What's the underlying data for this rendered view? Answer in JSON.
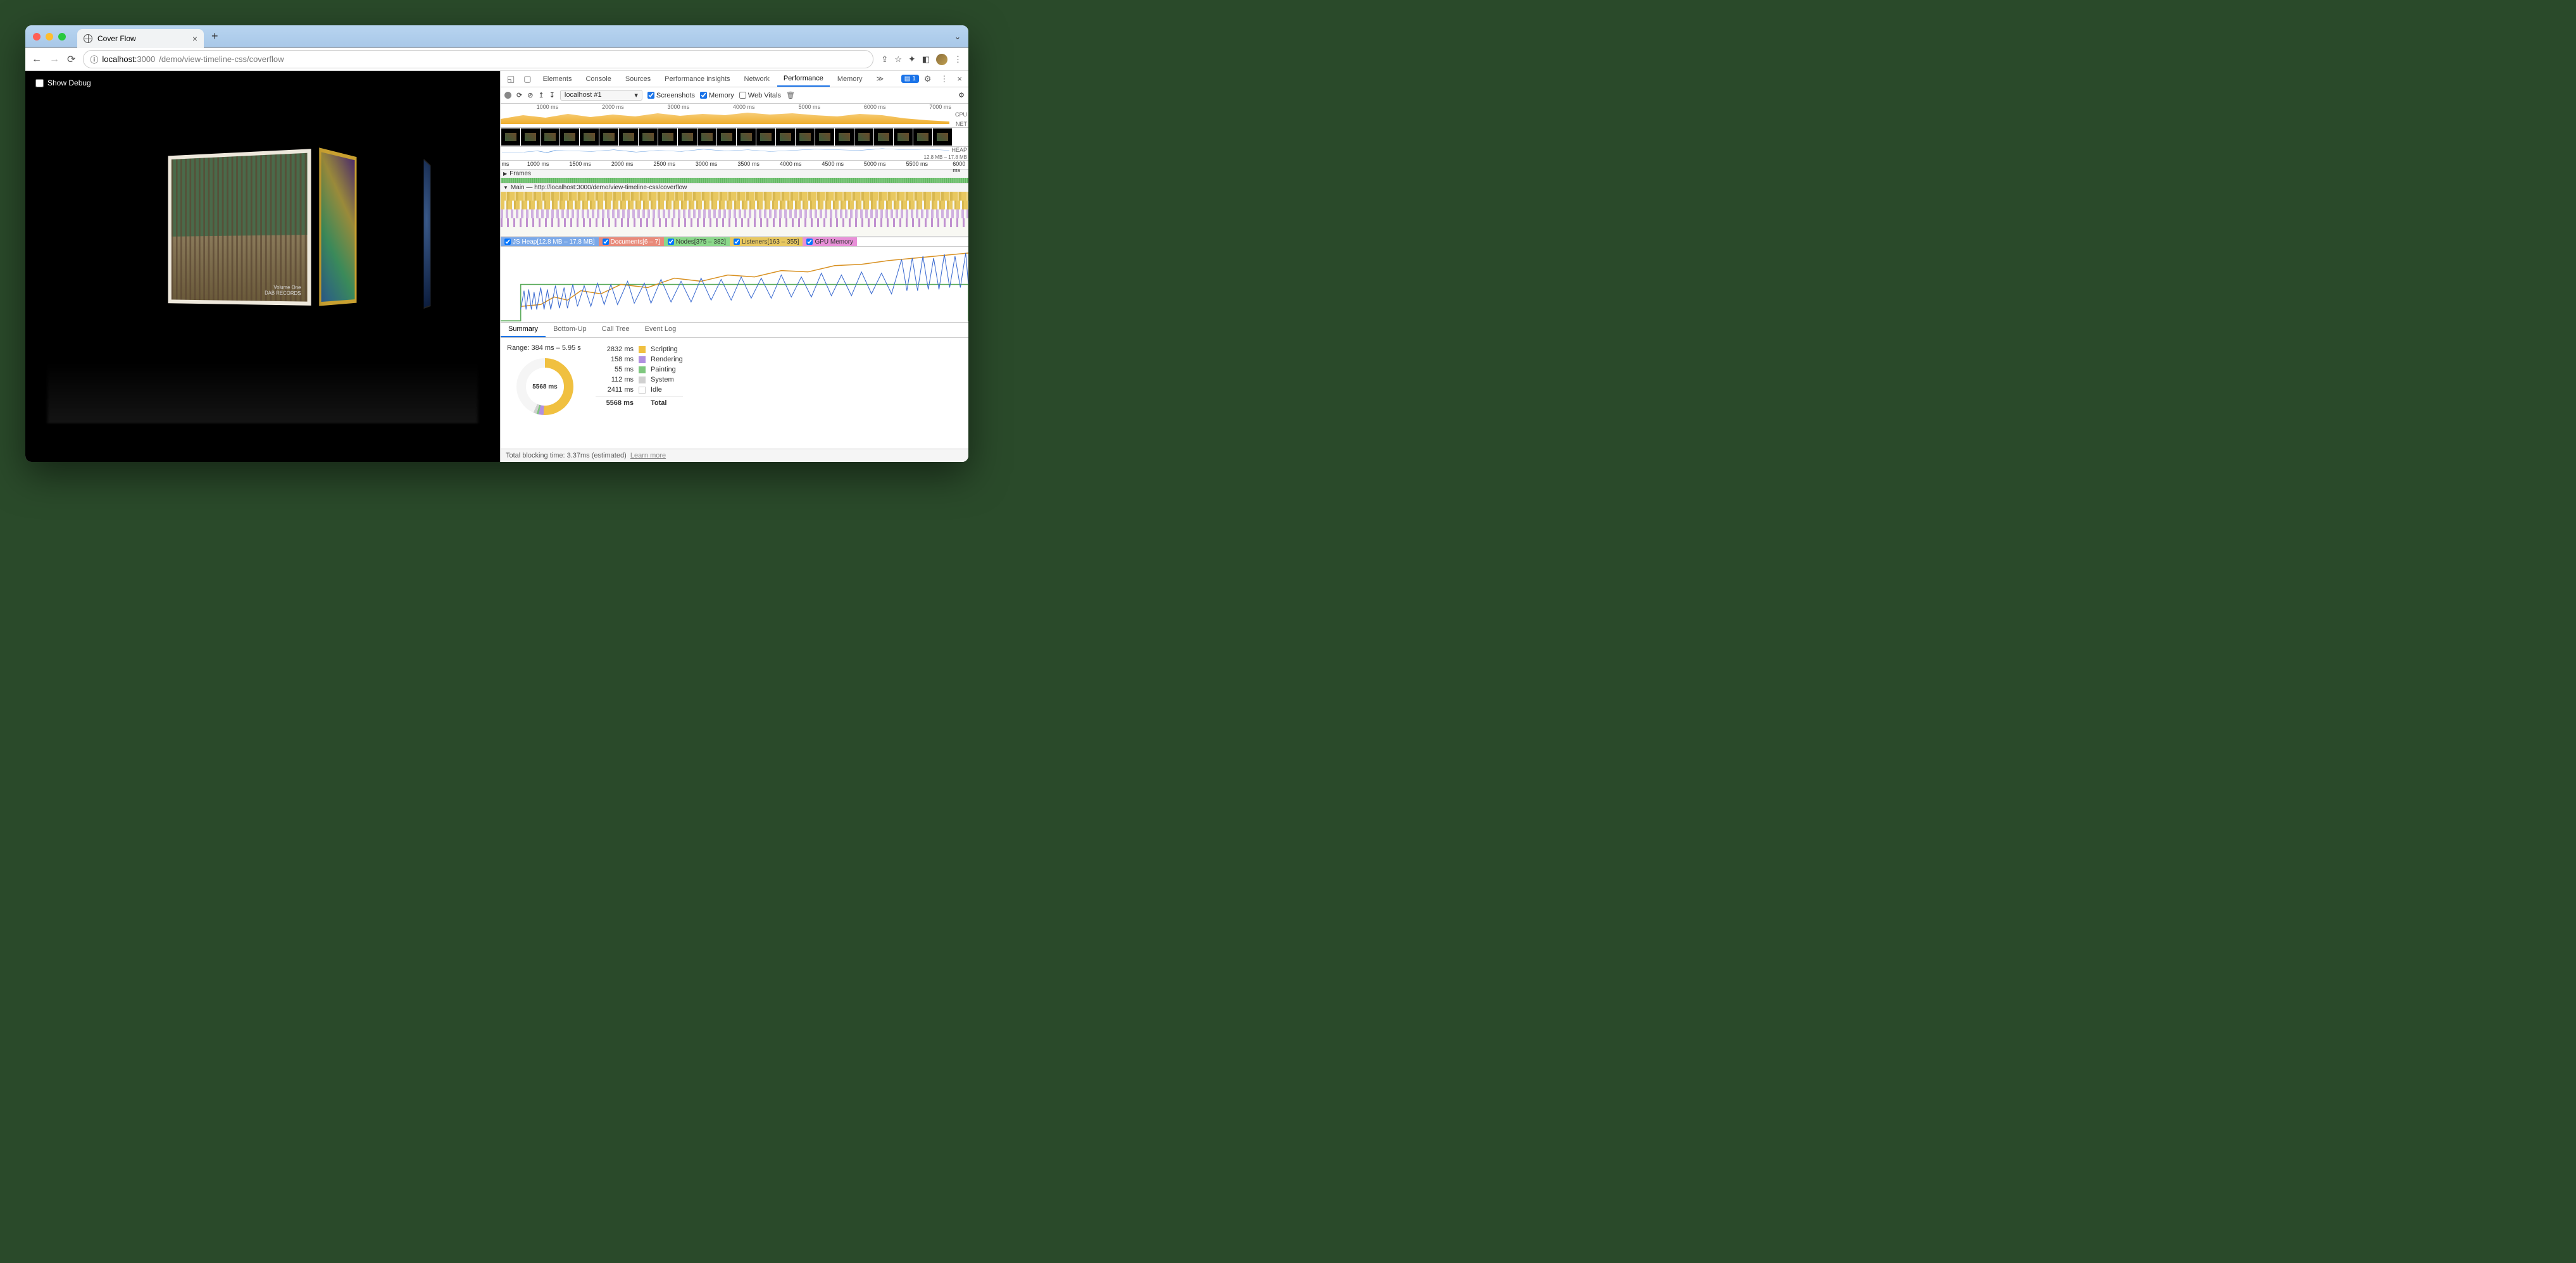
{
  "browser": {
    "tab_title": "Cover Flow",
    "url_host": "localhost:",
    "url_port": "3000",
    "url_path": "/demo/view-timeline-css/coverflow"
  },
  "page": {
    "debug_label": "Show Debug",
    "cover_main_label": "Volume One\nDAB RECORDS"
  },
  "devtools": {
    "tabs": [
      "Elements",
      "Console",
      "Sources",
      "Performance insights",
      "Network",
      "Performance",
      "Memory"
    ],
    "active_tab": "Performance",
    "more": "≫",
    "issue_count": "1",
    "toolbar": {
      "profile_select": "localhost #1",
      "screenshots": "Screenshots",
      "memory": "Memory",
      "web_vitals": "Web Vitals"
    },
    "overview_ticks": [
      "1000 ms",
      "2000 ms",
      "3000 ms",
      "4000 ms",
      "5000 ms",
      "6000 ms",
      "7000 ms"
    ],
    "cpu_label": "CPU",
    "net_label": "NET",
    "heap_label": "HEAP",
    "heap_range": "12.8 MB – 17.8 MB",
    "ruler2_ticks": [
      "ms",
      "1000 ms",
      "1500 ms",
      "2000 ms",
      "2500 ms",
      "3000 ms",
      "3500 ms",
      "4000 ms",
      "4500 ms",
      "5000 ms",
      "5500 ms",
      "6000 ms"
    ],
    "frames_label": "Frames",
    "main_label": "Main — http://localhost:3000/demo/view-timeline-css/coverflow",
    "counters": {
      "heap": "JS Heap[12.8 MB – 17.8 MB]",
      "docs": "Documents[6 – 7]",
      "nodes": "Nodes[375 – 382]",
      "listeners": "Listeners[163 – 355]",
      "gpu": "GPU Memory"
    },
    "detail_tabs": [
      "Summary",
      "Bottom-Up",
      "Call Tree",
      "Event Log"
    ],
    "range": "Range: 384 ms – 5.95 s",
    "donut_total": "5568 ms",
    "legend": [
      {
        "ms": "2832 ms",
        "label": "Scripting",
        "cls": "script"
      },
      {
        "ms": "158 ms",
        "label": "Rendering",
        "cls": "render"
      },
      {
        "ms": "55 ms",
        "label": "Painting",
        "cls": "paint"
      },
      {
        "ms": "112 ms",
        "label": "System",
        "cls": "sys"
      },
      {
        "ms": "2411 ms",
        "label": "Idle",
        "cls": "idle"
      }
    ],
    "total_row": {
      "ms": "5568 ms",
      "label": "Total"
    },
    "footer": "Total blocking time: 3.37ms (estimated)",
    "footer_link": "Learn more"
  },
  "chart_data": {
    "type": "pie",
    "title": "Performance Summary",
    "series": [
      {
        "name": "Scripting",
        "value": 2832,
        "unit": "ms"
      },
      {
        "name": "Rendering",
        "value": 158,
        "unit": "ms"
      },
      {
        "name": "Painting",
        "value": 55,
        "unit": "ms"
      },
      {
        "name": "System",
        "value": 112,
        "unit": "ms"
      },
      {
        "name": "Idle",
        "value": 2411,
        "unit": "ms"
      }
    ],
    "total": 5568
  }
}
